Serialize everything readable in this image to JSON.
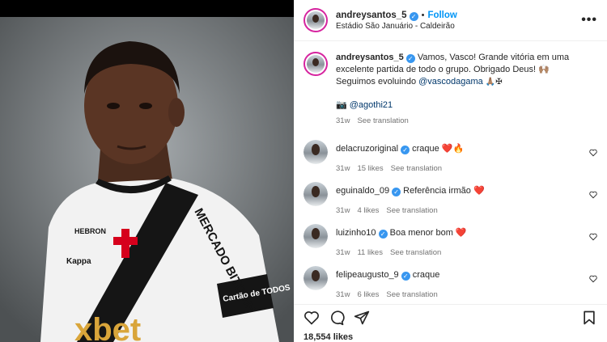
{
  "post": {
    "username": "andreysantos_5",
    "follow_label": "Follow",
    "location": "Estádio São Januário - Caldeirão",
    "more_label": "•••",
    "caption_text": "Vamos, Vasco! Grande vitória em uma excelente partida de todo o grupo. Obrigado Deus! 🙌🏽 Seguimos evoluindo",
    "caption_mention": "@vascodagama",
    "caption_end": "🙏🏽✠",
    "credit_prefix": "📷",
    "credit_mention": "@agothi21",
    "time": "31w",
    "see_translation": "See translation"
  },
  "comments": [
    {
      "username": "delacruzoriginal",
      "text": "craque ❤️🔥",
      "time": "31w",
      "likes": "15 likes",
      "see_translation": "See translation"
    },
    {
      "username": "eguinaldo_09",
      "text": "Referência irmão ❤️",
      "time": "31w",
      "likes": "4 likes",
      "see_translation": "See translation"
    },
    {
      "username": "luizinho10",
      "text": "Boa menor bom ❤️",
      "time": "31w",
      "likes": "11 likes",
      "see_translation": "See translation"
    },
    {
      "username": "felipeaugusto_9",
      "text": "craque",
      "time": "31w",
      "likes": "6 likes",
      "see_translation": "See translation"
    }
  ],
  "footer": {
    "likes": "18,554 likes"
  },
  "photo_text": {
    "sponsor": "MERCADO BITCOIN",
    "kit_sponsor": "HEBRON",
    "brand": "Kappa",
    "badge": "Cartão de TODOS",
    "shirt_logo": "xbet"
  },
  "colors": {
    "accent": "#0095f6",
    "verified": "#3897f0",
    "heart": "#ed4956",
    "cross": "#d6001c"
  }
}
